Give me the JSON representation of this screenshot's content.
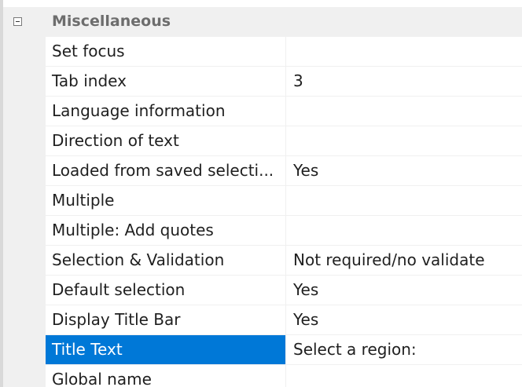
{
  "category": {
    "label": "Miscellaneous",
    "expanded": true
  },
  "properties": [
    {
      "name": "Set focus",
      "value": ""
    },
    {
      "name": "Tab index",
      "value": "3"
    },
    {
      "name": "Language information",
      "value": ""
    },
    {
      "name": "Direction of text",
      "value": ""
    },
    {
      "name": "Loaded from saved selecti...",
      "value": "Yes"
    },
    {
      "name": "Multiple",
      "value": ""
    },
    {
      "name": "Multiple: Add quotes",
      "value": ""
    },
    {
      "name": "Selection & Validation",
      "value": "Not required/no validate"
    },
    {
      "name": "Default selection",
      "value": "Yes"
    },
    {
      "name": "Display Title Bar",
      "value": "Yes"
    },
    {
      "name": "Title Text",
      "value": "Select a region:",
      "selected": true
    },
    {
      "name": "Global name",
      "value": ""
    }
  ],
  "colors": {
    "selection": "#0078d7",
    "gridline": "#f0f0f0",
    "category_text": "#6d6d6d"
  }
}
